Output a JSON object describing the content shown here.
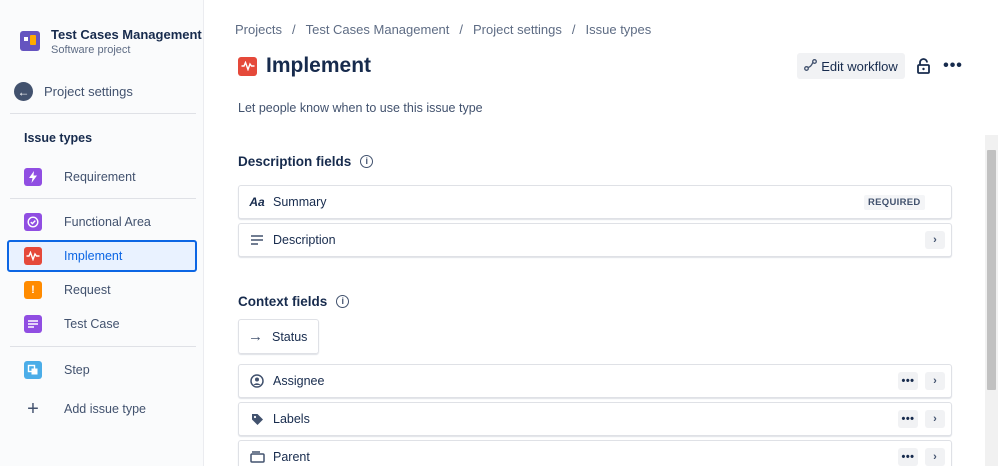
{
  "project": {
    "name": "Test Cases Management",
    "type": "Software project"
  },
  "sidebar": {
    "back_label": "Project settings",
    "section_title": "Issue types",
    "items": [
      {
        "label": "Requirement",
        "icon": "lightning-icon",
        "color": "#904ee2"
      },
      {
        "label": "Functional Area",
        "icon": "check-circle-icon",
        "color": "#904ee2"
      },
      {
        "label": "Implement",
        "icon": "pulse-icon",
        "color": "#e5493a",
        "active": true
      },
      {
        "label": "Request",
        "icon": "exclamation-icon",
        "color": "#ff8b00"
      },
      {
        "label": "Test Case",
        "icon": "lines-icon",
        "color": "#904ee2"
      },
      {
        "label": "Step",
        "icon": "step-icon",
        "color": "#4bade8"
      },
      {
        "label": "Add issue type",
        "icon": "plus-icon",
        "color": "#42526e"
      }
    ]
  },
  "breadcrumb": [
    "Projects",
    "Test Cases Management",
    "Project settings",
    "Issue types"
  ],
  "header": {
    "title": "Implement",
    "edit_workflow_label": "Edit workflow",
    "subtitle": "Let people know when to use this issue type"
  },
  "description_fields": {
    "title": "Description fields",
    "items": [
      {
        "label": "Summary",
        "icon": "text-aa-icon",
        "badge": "REQUIRED"
      },
      {
        "label": "Description",
        "icon": "paragraph-icon"
      }
    ]
  },
  "context_fields": {
    "title": "Context fields",
    "status_label": "Status",
    "items": [
      {
        "label": "Assignee",
        "icon": "user-circle-icon"
      },
      {
        "label": "Labels",
        "icon": "tag-icon"
      },
      {
        "label": "Parent",
        "icon": "parent-icon"
      }
    ]
  },
  "colors": {
    "accent": "#0c66e4",
    "active_bg": "#e9f2ff",
    "implement_red": "#e5493a"
  }
}
